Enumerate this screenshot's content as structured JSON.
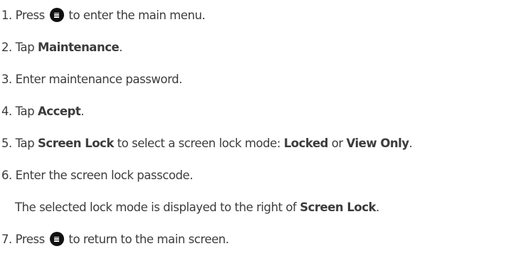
{
  "steps": [
    {
      "num": "1.",
      "pre": "Press",
      "icon": "menu-button-icon",
      "post": "to enter the main menu."
    },
    {
      "num": "2.",
      "text": "Tap",
      "bold": "Maintenance",
      "end": "."
    },
    {
      "num": "3.",
      "text": "Enter maintenance password."
    },
    {
      "num": "4.",
      "text": "Tap",
      "bold": "Accept",
      "end": "."
    },
    {
      "num": "5.",
      "text": "Tap",
      "bold": "Screen Lock",
      "mid": "to select a screen lock mode:",
      "opt1": "Locked",
      "or": "or",
      "opt2": "View Only",
      "end": "."
    },
    {
      "num": "6.",
      "text": "Enter the screen lock passcode."
    },
    {
      "note_pre": "The selected lock mode is displayed to the right of",
      "note_bold": "Screen Lock",
      "note_end": "."
    },
    {
      "num": "7.",
      "pre": "Press",
      "icon": "menu-button-icon",
      "post": "to return to the main screen."
    }
  ]
}
